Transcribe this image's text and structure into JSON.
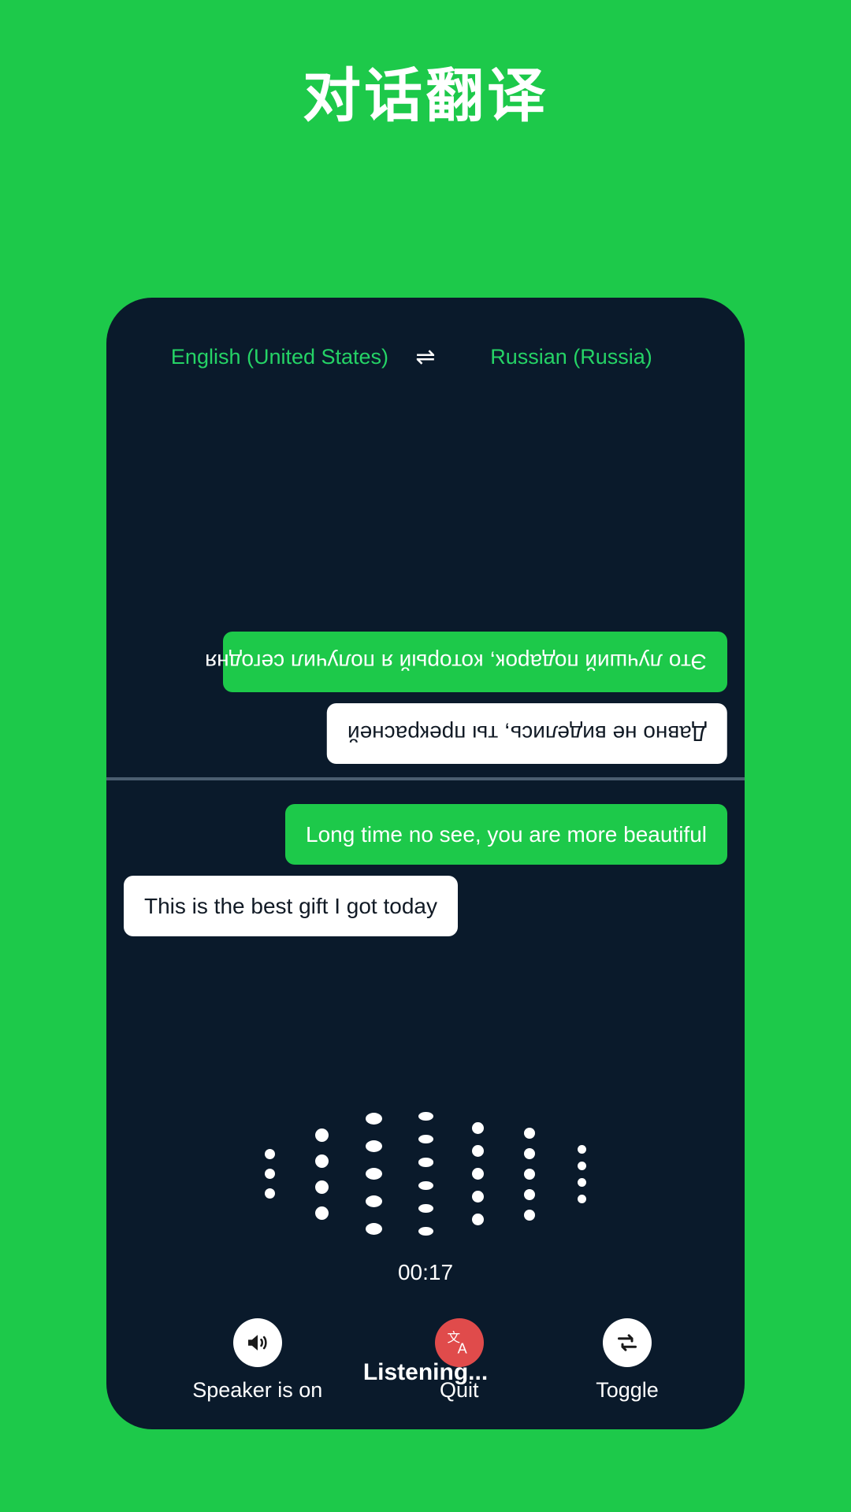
{
  "headline": "对话翻译",
  "colors": {
    "brand_green": "#1DC94A",
    "card_navy": "#0A1A2B",
    "accent_green_text": "#25D366",
    "quit_red": "#E04B4B",
    "divider": "#4B5E70",
    "white": "#FFFFFF"
  },
  "language_bar": {
    "source": "English (United States)",
    "target": "Russian (Russia)",
    "swap_glyph": "⇌"
  },
  "remote_messages": [
    {
      "text": "Это лучший подарок, который я получил сегодня",
      "style": "green",
      "align": "right"
    },
    {
      "text": "Давно не виделись, ты прекрасней",
      "style": "white",
      "align": "left"
    }
  ],
  "local_messages": [
    {
      "text": "Long time no see, you are more beautiful",
      "style": "green",
      "align": "right"
    },
    {
      "text": "This is the best gift I got today",
      "style": "white",
      "align": "left"
    }
  ],
  "status": {
    "listening_label": "Listening...",
    "timer": "00:17"
  },
  "waveform": {
    "columns": [
      {
        "dots": 3,
        "size": 13
      },
      {
        "dots": 4,
        "size": 17
      },
      {
        "dots": 5,
        "size": 21
      },
      {
        "dots": 6,
        "size": 19
      },
      {
        "dots": 5,
        "size": 15
      },
      {
        "dots": 5,
        "size": 14
      },
      {
        "dots": 4,
        "size": 11
      }
    ]
  },
  "controls": [
    {
      "label": "Speaker is on",
      "icon": "speaker-icon",
      "variant": "light"
    },
    {
      "label": "Quit",
      "icon": "translate-icon",
      "variant": "danger"
    },
    {
      "label": "Toggle",
      "icon": "swap-repeat-icon",
      "variant": "light"
    }
  ]
}
